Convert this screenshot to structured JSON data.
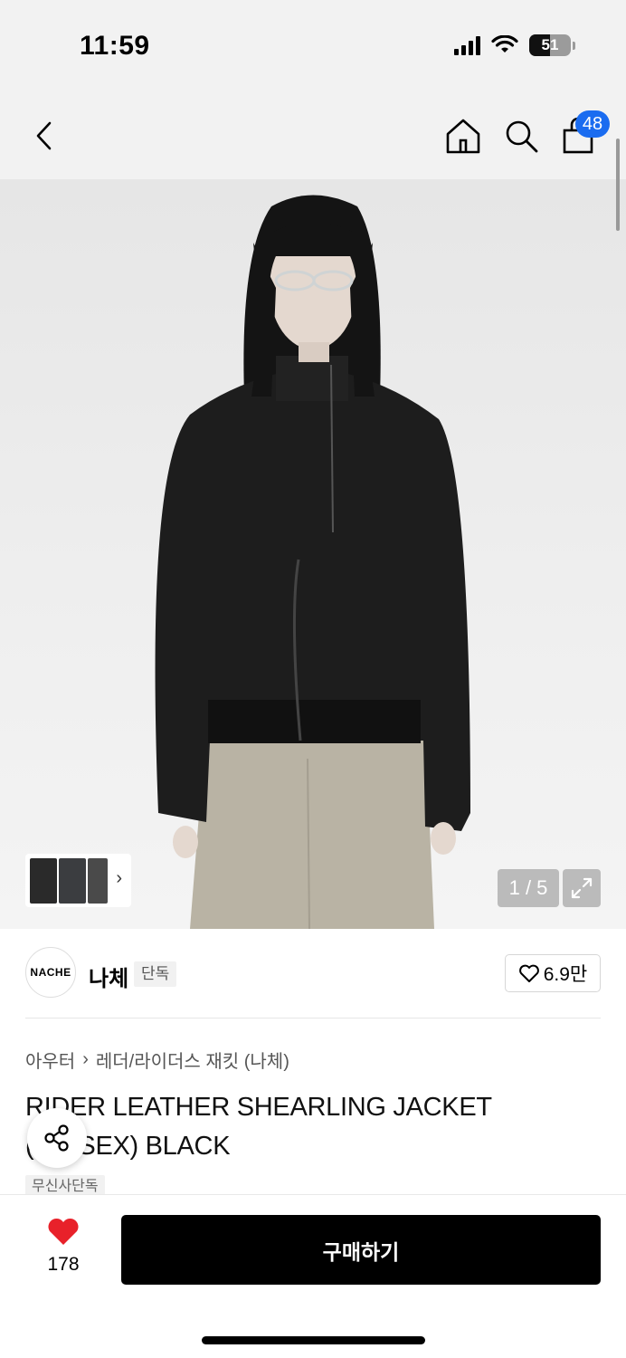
{
  "status": {
    "time": "11:59",
    "battery": "51",
    "battery_level": 0.51
  },
  "header": {
    "cart_badge": "48"
  },
  "gallery": {
    "counter": "1 / 5",
    "current": 1,
    "total": 5
  },
  "brand": {
    "logo_text": "NACHE",
    "name": "나체",
    "exclusive_tag": "단독",
    "likes": "6.9만"
  },
  "breadcrumb": {
    "category": "아우터",
    "subcategory": "레더/라이더스 재킷 (나체)"
  },
  "product": {
    "title": "RIDER LEATHER SHEARLING JACKET (UNISEX) BLACK",
    "store_tag": "무신사단독"
  },
  "bottom": {
    "wish_count": "178",
    "buy_label": "구매하기"
  },
  "colors": {
    "badge": "#1a6cf0",
    "heart": "#e8212a",
    "buy_button": "#000000"
  },
  "icons": [
    "back-icon",
    "home-icon",
    "search-icon",
    "cart-icon",
    "expand-icon",
    "share-icon",
    "heart-icon",
    "chevron-right-icon"
  ]
}
